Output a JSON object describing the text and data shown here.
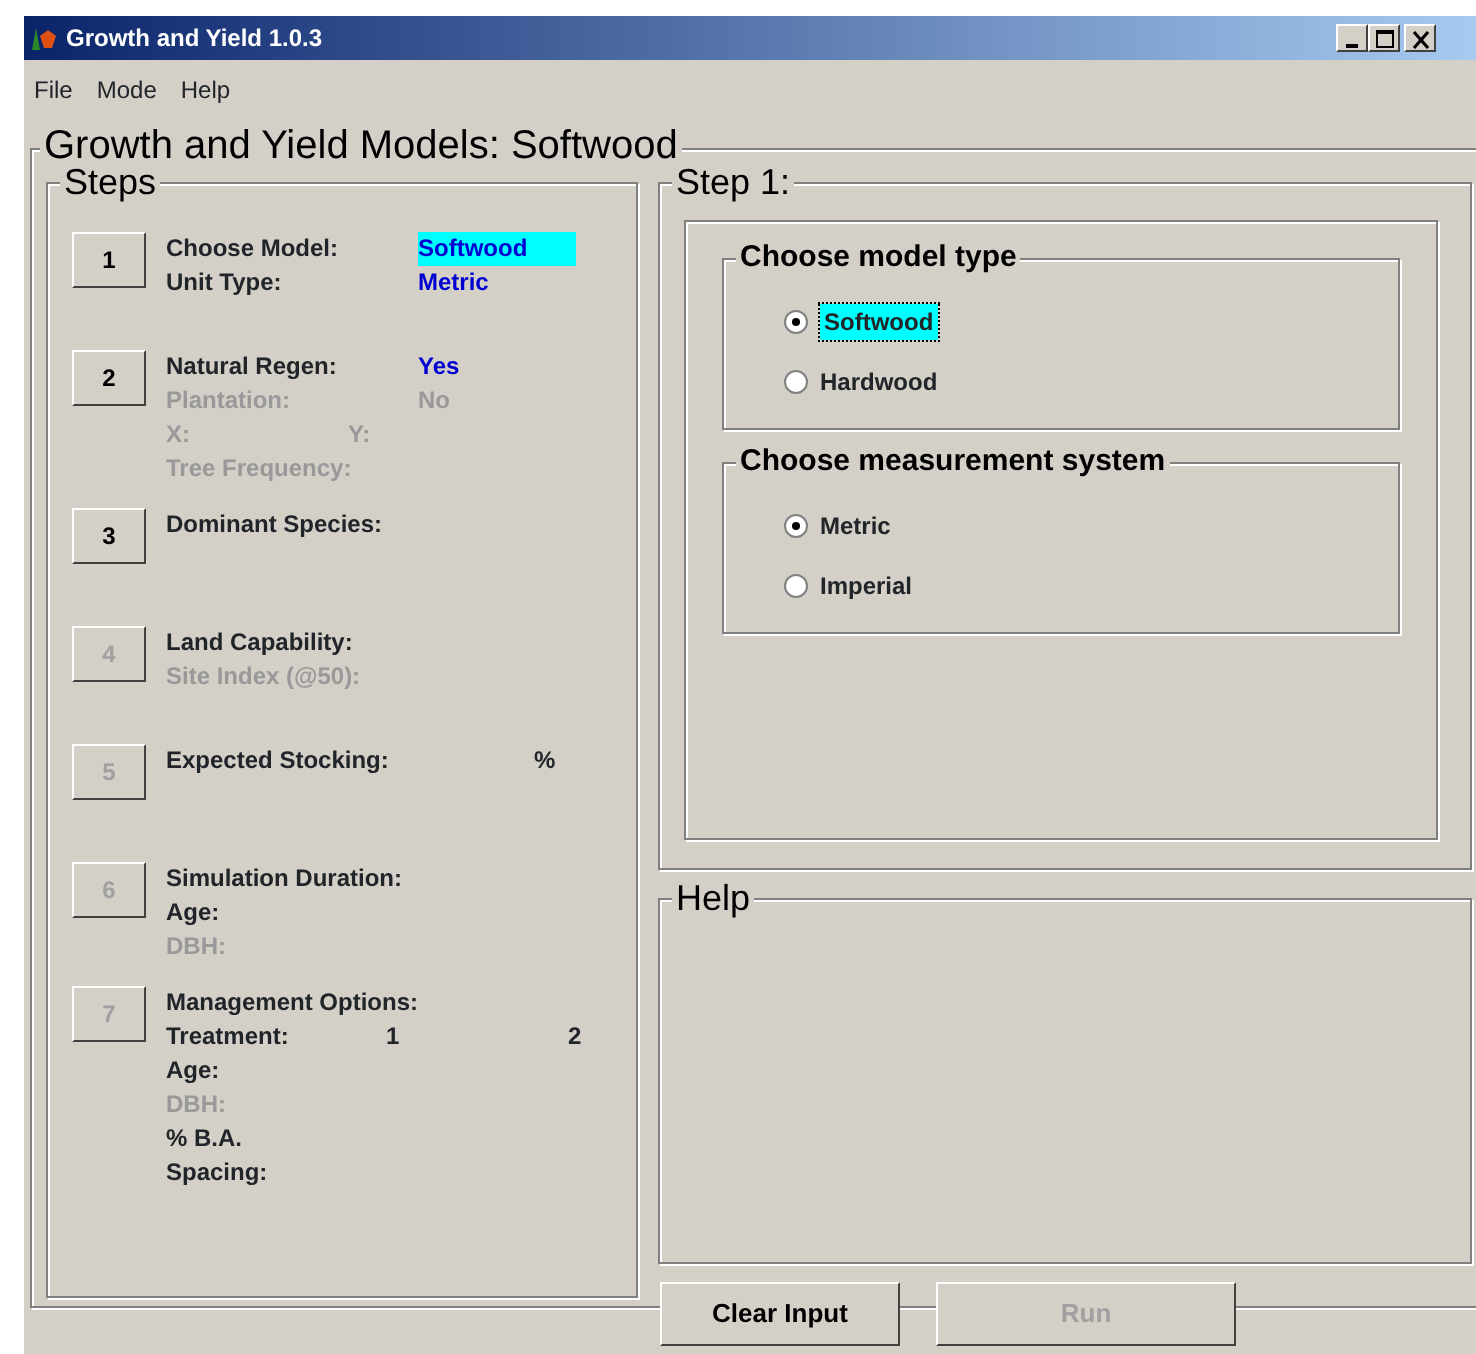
{
  "window": {
    "title": "Growth and Yield 1.0.3"
  },
  "menu": [
    "File",
    "Mode",
    "Help"
  ],
  "main_group": {
    "title": "Growth and Yield Models: Softwood"
  },
  "steps_panel": {
    "title": "Steps",
    "steps": [
      {
        "number": "1",
        "disabled": false,
        "lines": [
          {
            "disabled": false,
            "parts": [
              {
                "text": "Choose Model:",
                "kind": "label"
              },
              {
                "text": "Softwood",
                "kind": "value",
                "highlighted": true
              }
            ]
          },
          {
            "disabled": false,
            "parts": [
              {
                "text": "Unit Type:",
                "kind": "label"
              },
              {
                "text": "Metric",
                "kind": "value",
                "highlighted": false
              }
            ]
          }
        ]
      },
      {
        "number": "2",
        "disabled": false,
        "lines": [
          {
            "disabled": false,
            "parts": [
              {
                "text": "Natural Regen:",
                "kind": "label"
              },
              {
                "text": "Yes",
                "kind": "value",
                "highlighted": false
              }
            ]
          },
          {
            "disabled": true,
            "parts": [
              {
                "text": "Plantation:",
                "kind": "label"
              },
              {
                "text": "No",
                "kind": "value",
                "highlighted": false
              }
            ]
          },
          {
            "disabled": true,
            "parts": [
              {
                "text": "X:",
                "kind": "short"
              },
              {
                "text": "Y:",
                "kind": "label"
              }
            ]
          },
          {
            "disabled": true,
            "parts": [
              {
                "text": "Tree Frequency:",
                "kind": "label"
              }
            ]
          }
        ]
      },
      {
        "number": "3",
        "disabled": false,
        "lines": [
          {
            "disabled": false,
            "parts": [
              {
                "text": "Dominant Species:",
                "kind": "label"
              }
            ]
          }
        ]
      },
      {
        "number": "4",
        "disabled": true,
        "lines": [
          {
            "disabled": false,
            "parts": [
              {
                "text": "Land Capability:",
                "kind": "label"
              }
            ]
          },
          {
            "disabled": true,
            "parts": [
              {
                "text": "Site Index (@50):",
                "kind": "label"
              }
            ]
          }
        ]
      },
      {
        "number": "5",
        "disabled": true,
        "lines": [
          {
            "disabled": false,
            "parts": [
              {
                "text": "Expected Stocking:",
                "kind": "wide"
              },
              {
                "text": "%",
                "kind": "label"
              }
            ]
          }
        ]
      },
      {
        "number": "6",
        "disabled": true,
        "lines": [
          {
            "disabled": false,
            "parts": [
              {
                "text": "Simulation Duration:",
                "kind": "label"
              }
            ]
          },
          {
            "disabled": false,
            "parts": [
              {
                "text": "Age:",
                "kind": "label"
              }
            ]
          },
          {
            "disabled": true,
            "parts": [
              {
                "text": "DBH:",
                "kind": "label"
              }
            ]
          }
        ]
      },
      {
        "number": "7",
        "disabled": true,
        "lines": [
          {
            "disabled": false,
            "parts": [
              {
                "text": "Management Options:",
                "kind": "label"
              }
            ]
          },
          {
            "disabled": false,
            "parts": [
              {
                "text": "Treatment:",
                "kind": "mid"
              },
              {
                "text": "1",
                "kind": "short"
              },
              {
                "text": "2",
                "kind": "label"
              }
            ]
          },
          {
            "disabled": false,
            "parts": [
              {
                "text": "Age:",
                "kind": "label"
              }
            ]
          },
          {
            "disabled": true,
            "parts": [
              {
                "text": "DBH:",
                "kind": "label"
              }
            ]
          },
          {
            "disabled": false,
            "parts": [
              {
                "text": "% B.A.",
                "kind": "label"
              }
            ]
          },
          {
            "disabled": false,
            "parts": [
              {
                "text": "Spacing:",
                "kind": "label"
              }
            ]
          }
        ]
      }
    ]
  },
  "step_panel": {
    "title": "Step 1:",
    "groups": [
      {
        "title": "Choose model type",
        "options": [
          {
            "label": "Softwood",
            "selected": true,
            "focused": true
          },
          {
            "label": "Hardwood",
            "selected": false,
            "focused": false
          }
        ]
      },
      {
        "title": "Choose measurement system",
        "options": [
          {
            "label": "Metric",
            "selected": true,
            "focused": false
          },
          {
            "label": "Imperial",
            "selected": false,
            "focused": false
          }
        ]
      }
    ]
  },
  "help_panel": {
    "title": "Help"
  },
  "buttons": [
    {
      "label": "Clear Input",
      "disabled": false
    },
    {
      "label": "Run",
      "disabled": true
    }
  ]
}
